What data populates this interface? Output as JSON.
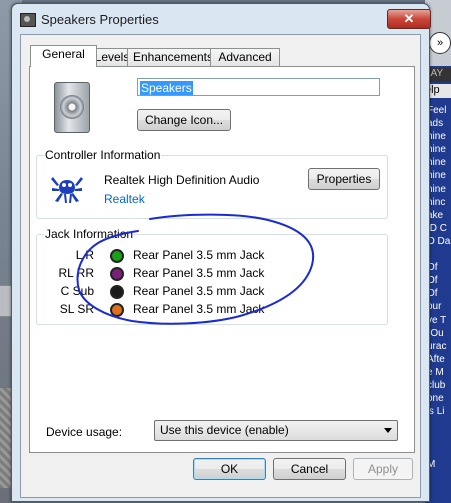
{
  "background": {
    "right_bar": {
      "play_glyph": "»",
      "header_text": "LAY",
      "help_text": "elp",
      "lines": [
        "Feel",
        "ads",
        "hine",
        "hine",
        "hine",
        "hine",
        "hine",
        "hinc",
        "ake",
        "ID C",
        "O Da",
        "",
        "Of",
        "Of",
        "Of",
        "our",
        "ve T",
        "(Ou",
        "urac",
        "Afte",
        "e M",
        "club",
        "one",
        "'s Li",
        "",
        "",
        "",
        "M"
      ]
    }
  },
  "window": {
    "title": "Speakers Properties",
    "close_glyph": "✕"
  },
  "tabs": [
    {
      "label": "General",
      "active": true
    },
    {
      "label": "Levels",
      "active": false
    },
    {
      "label": "Enhancements",
      "active": false
    },
    {
      "label": "Advanced",
      "active": false
    }
  ],
  "general": {
    "device_icon": "speaker-icon",
    "device_name": "Speakers",
    "change_icon_label": "Change Icon...",
    "controller": {
      "group_label": "Controller Information",
      "logo_icon": "realtek-crab-logo",
      "name": "Realtek High Definition Audio",
      "link": "Realtek",
      "properties_label": "Properties"
    },
    "jack": {
      "group_label": "Jack Information",
      "rows": [
        {
          "channel": "L R",
          "color": "#18a018",
          "description": "Rear Panel 3.5 mm Jack"
        },
        {
          "channel": "RL RR",
          "color": "#7a1f7a",
          "description": "Rear Panel 3.5 mm Jack"
        },
        {
          "channel": "C Sub",
          "color": "#1a1a1a",
          "description": "Rear Panel 3.5 mm Jack"
        },
        {
          "channel": "SL SR",
          "color": "#e0701e",
          "description": "Rear Panel 3.5 mm Jack"
        }
      ]
    },
    "device_usage": {
      "label": "Device usage:",
      "selected": "Use this device (enable)"
    }
  },
  "buttons": {
    "ok": "OK",
    "cancel": "Cancel",
    "apply": "Apply"
  },
  "annotation": {
    "color": "#1a2bd6"
  }
}
